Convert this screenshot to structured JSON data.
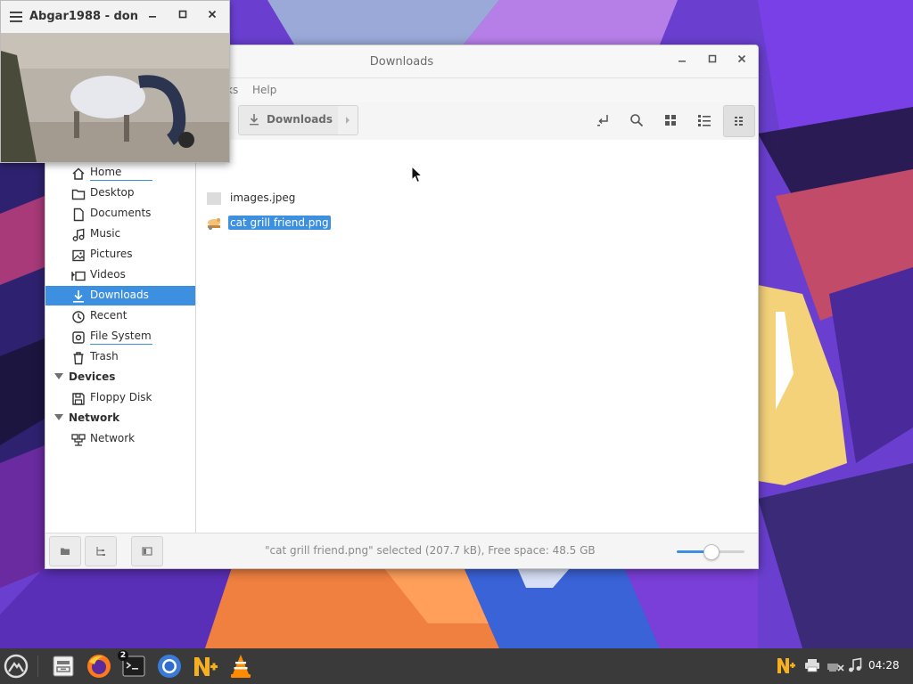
{
  "file_manager": {
    "title": "Downloads",
    "menu": [
      "ks",
      "Help"
    ],
    "path_button": "Downloads",
    "sidebar": {
      "places": [
        {
          "label": "Home",
          "icon": "home-icon"
        },
        {
          "label": "Desktop",
          "icon": "folder-icon"
        },
        {
          "label": "Documents",
          "icon": "document-icon"
        },
        {
          "label": "Music",
          "icon": "music-icon"
        },
        {
          "label": "Pictures",
          "icon": "image-icon"
        },
        {
          "label": "Videos",
          "icon": "video-icon"
        },
        {
          "label": "Downloads",
          "icon": "download-icon",
          "selected": true
        },
        {
          "label": "Recent",
          "icon": "clock-icon"
        },
        {
          "label": "File System",
          "icon": "drive-icon"
        },
        {
          "label": "Trash",
          "icon": "trash-icon"
        }
      ],
      "devices_header": "Devices",
      "devices": [
        {
          "label": "Floppy Disk",
          "icon": "floppy-icon"
        }
      ],
      "network_header": "Network",
      "network": [
        {
          "label": "Network",
          "icon": "network-icon"
        }
      ]
    },
    "files": [
      {
        "name": "images.jpeg",
        "selected": false
      },
      {
        "name": "cat grill friend.png",
        "selected": true
      }
    ],
    "status": "\"cat grill friend.png\" selected (207.7 kB), Free space: 48.5 GB",
    "zoom_level": 0.5
  },
  "video_window": {
    "title": "Abgar1988 - don..."
  },
  "taskbar": {
    "clock": "04:28",
    "terminal_badge": "2",
    "apps": [
      "start-menu-icon",
      "file-manager-icon",
      "firefox-icon",
      "terminal-icon",
      "chromium-icon",
      "noteshrink-icon",
      "vlc-icon"
    ],
    "tray": [
      "updates-icon",
      "printer-icon",
      "network-disconnected-icon",
      "volume-icon"
    ]
  },
  "colors": {
    "accent": "#3d8fe0",
    "taskbar": "#3a3a3a",
    "wallpaper_purple": "#6a3fd0"
  }
}
